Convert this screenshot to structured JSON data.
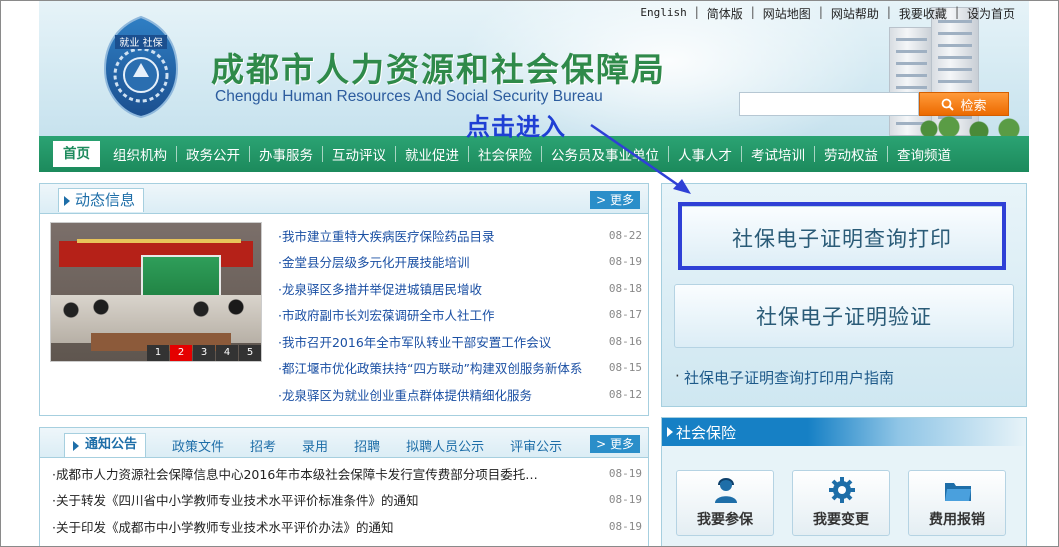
{
  "header": {
    "org_name_cn": "成都市人力资源和社会保障局",
    "org_name_en": "Chengdu Human Resources And Social Security Bureau",
    "logo_text": "就业 社保",
    "top_links": [
      "English",
      "简体版",
      "网站地图",
      "网站帮助",
      "我要收藏",
      "设为首页"
    ],
    "search": {
      "placeholder": "",
      "button_label": "检索"
    }
  },
  "annotation": {
    "text": "点击进入"
  },
  "nav": {
    "items": [
      "首页",
      "组织机构",
      "政务公开",
      "办事服务",
      "互动评议",
      "就业促进",
      "社会保险",
      "公务员及事业单位",
      "人事人才",
      "考试培训",
      "劳动权益",
      "查询频道"
    ],
    "active_index": 0
  },
  "news": {
    "title": "动态信息",
    "more_label": "> 更多",
    "carousel_pages": [
      "1",
      "2",
      "3",
      "4",
      "5"
    ],
    "carousel_current": 1,
    "items": [
      {
        "title": "·我市建立重特大疾病医疗保险药品目录",
        "date": "08-22"
      },
      {
        "title": "·金堂县分层级多元化开展技能培训",
        "date": "08-19"
      },
      {
        "title": "·龙泉驿区多措并举促进城镇居民增收",
        "date": "08-18"
      },
      {
        "title": "·市政府副市长刘宏葆调研全市人社工作",
        "date": "08-17"
      },
      {
        "title": "·我市召开2016年全市军队转业干部安置工作会议",
        "date": "08-16"
      },
      {
        "title": "·都江堰市优化政策扶持“四方联动”构建双创服务新体系",
        "date": "08-15"
      },
      {
        "title": "·龙泉驿区为就业创业重点群体提供精细化服务",
        "date": "08-12"
      }
    ]
  },
  "notice": {
    "tabs": [
      "通知公告",
      "政策文件",
      "招考",
      "录用",
      "招聘",
      "拟聘人员公示",
      "评审公示"
    ],
    "more_label": "> 更多",
    "items": [
      {
        "title": "·成都市人力资源社会保障信息中心2016年市本级社会保障卡发行宣传费部分项目委托…",
        "date": "08-19"
      },
      {
        "title": "·关于转发《四川省中小学教师专业技术水平评价标准条件》的通知",
        "date": "08-19"
      },
      {
        "title": "·关于印发《成都市中小学教师专业技术水平评价办法》的通知",
        "date": "08-19"
      }
    ]
  },
  "right": {
    "print_button": "社保电子证明查询打印",
    "verify_button": "社保电子证明验证",
    "guide_link": "社保电子证明查询打印用户指南"
  },
  "social": {
    "title": "社会保险",
    "services": [
      {
        "label": "我要参保",
        "icon": "person-headset-icon"
      },
      {
        "label": "我要变更",
        "icon": "gear-icon"
      },
      {
        "label": "费用报销",
        "icon": "folder-icon"
      }
    ]
  },
  "colors": {
    "nav_green": "#1c8a5c",
    "org_name_green": "#2f8a4a",
    "link_blue": "#1a4fa3",
    "annotation_blue": "#2f40d6",
    "search_orange": "#ec6a00"
  }
}
